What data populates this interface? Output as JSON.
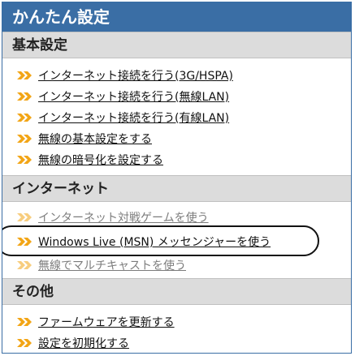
{
  "panel": {
    "title": "かんたん設定"
  },
  "sections": {
    "basic": {
      "header": "基本設定",
      "items": [
        {
          "label": "インターネット接続を行う(3G/HSPA)"
        },
        {
          "label": "インターネット接続を行う(無線LAN)"
        },
        {
          "label": "インターネット接続を行う(有線LAN)"
        },
        {
          "label": "無線の基本設定をする"
        },
        {
          "label": "無線の暗号化を設定する"
        }
      ]
    },
    "internet": {
      "header": "インターネット",
      "items": [
        {
          "label": "インターネット対戦ゲームを使う"
        },
        {
          "label": "Windows Live (MSN) メッセンジャーを使う"
        },
        {
          "label": "無線でマルチキャストを使う"
        }
      ]
    },
    "other": {
      "header": "その他",
      "items": [
        {
          "label": "ファームウェアを更新する"
        },
        {
          "label": "設定を初期化する"
        }
      ]
    }
  },
  "colors": {
    "accent": "#3a6ea5",
    "chevron": "#f2a516",
    "section_bg": "#dcdcdc"
  },
  "icons": {
    "link_bullet": "double-chevron-right-icon"
  }
}
